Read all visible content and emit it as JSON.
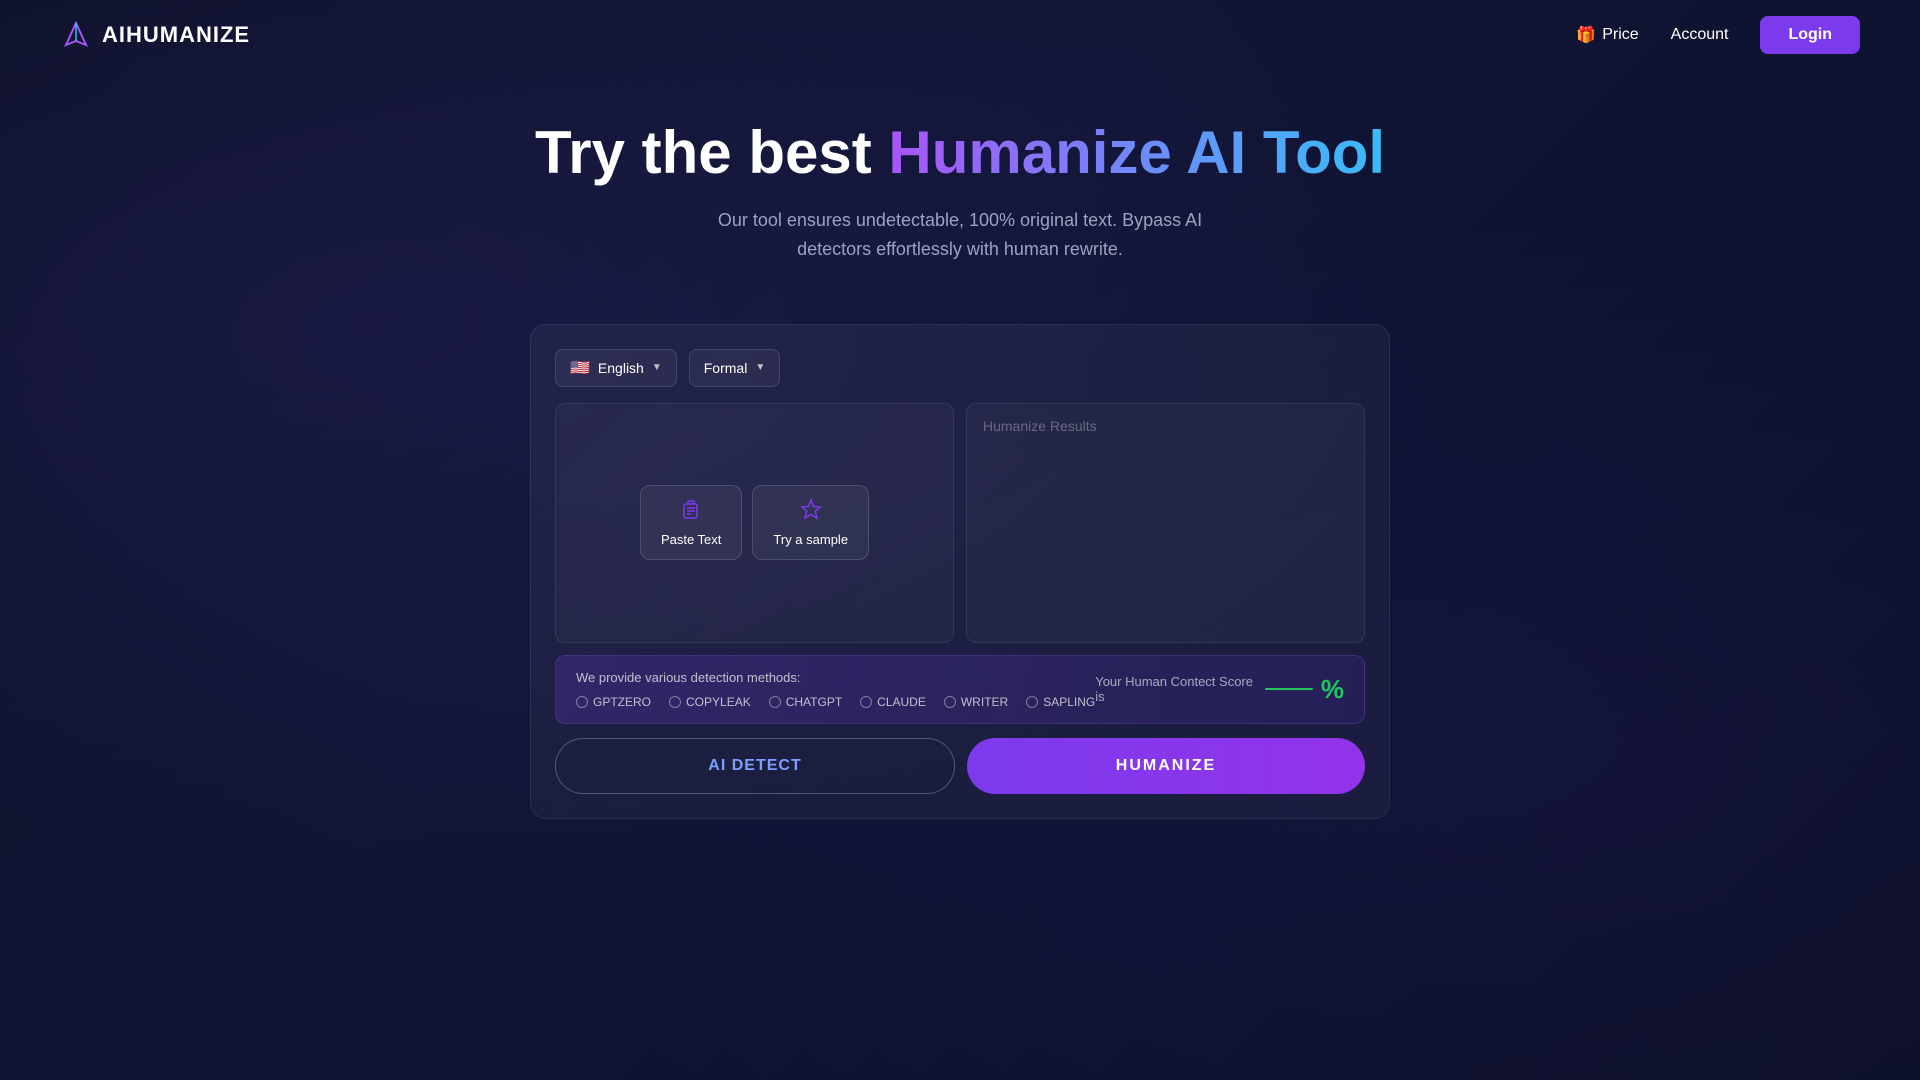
{
  "header": {
    "logo_text": "AIHUMANIZE",
    "price_label": "Price",
    "price_icon": "🎁",
    "account_label": "Account",
    "login_label": "Login"
  },
  "hero": {
    "title_part1": "Try the best ",
    "title_part2": "Humanize AI Tool",
    "subtitle": "Our tool ensures undetectable, 100% original text. Bypass AI detectors effortlessly with human rewrite."
  },
  "tool": {
    "language_dropdown": {
      "flag": "🇺🇸",
      "label": "English"
    },
    "style_dropdown": {
      "label": "Formal"
    },
    "input_placeholder": "",
    "output_placeholder": "Humanize Results",
    "paste_text_label": "Paste Text",
    "try_sample_label": "Try a sample",
    "detection_info_label": "We provide various detection methods:",
    "detection_methods": [
      "GPTZERO",
      "COPYLEAK",
      "CHATGPT",
      "CLAUDE",
      "WRITER",
      "SAPLING"
    ],
    "score_label": "Your Human Contect Score is",
    "score_unit": "%",
    "ai_detect_label": "AI DETECT",
    "humanize_label": "HUMANIZE"
  }
}
